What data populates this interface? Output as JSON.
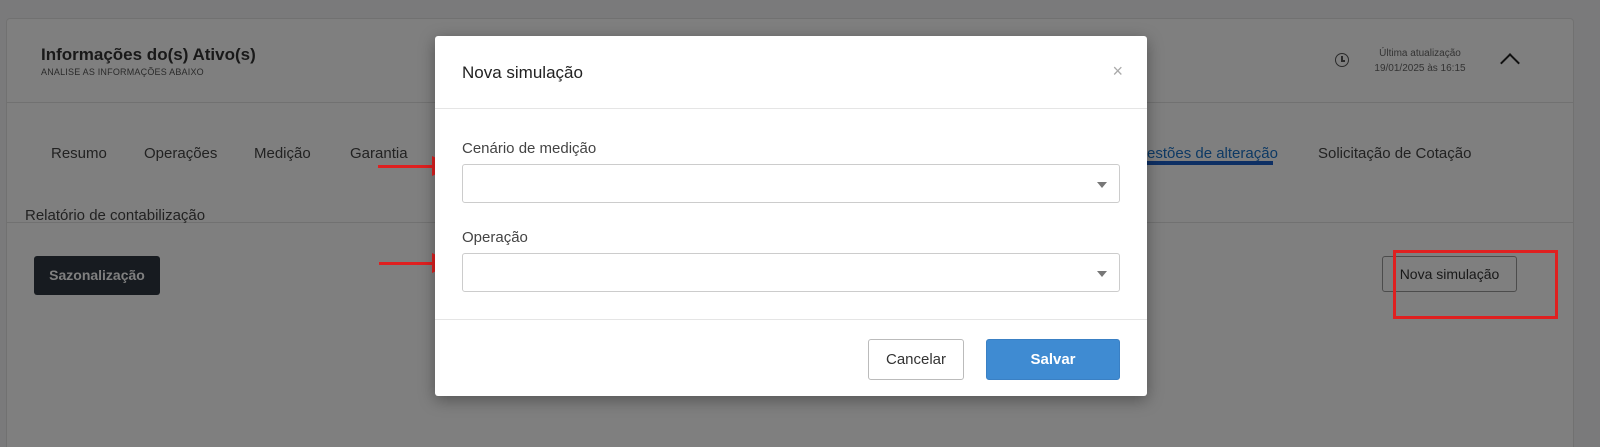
{
  "page": {
    "title": "Informações do(s) Ativo(s)",
    "subtitle": "ANALISE AS INFORMAÇÕES ABAIXO",
    "last_update_label": "Última atualização",
    "last_update_value": "19/01/2025 às 16:15",
    "clock_icon": "clock-icon",
    "collapse_icon": "chevron-up-icon"
  },
  "tabs": [
    {
      "label": "Resumo"
    },
    {
      "label": "Operações"
    },
    {
      "label": "Medição"
    },
    {
      "label": "Garantia"
    },
    {
      "label": "estões de alteração",
      "active": true
    },
    {
      "label": "Solicitação de Cotação"
    },
    {
      "label": "Relatório de contabilização"
    }
  ],
  "actions": {
    "sazonalizacao_label": "Sazonalização",
    "nova_simulacao_label": "Nova simulação"
  },
  "modal": {
    "title": "Nova simulação",
    "close_symbol": "×",
    "fields": [
      {
        "label": "Cenário de medição",
        "value": ""
      },
      {
        "label": "Operação",
        "value": ""
      }
    ],
    "cancel_label": "Cancelar",
    "save_label": "Salvar"
  },
  "colors": {
    "accent": "#1a73c8",
    "save_button": "#3f8bd2",
    "annotation": "#e02020",
    "dark_button": "#2e3740"
  }
}
